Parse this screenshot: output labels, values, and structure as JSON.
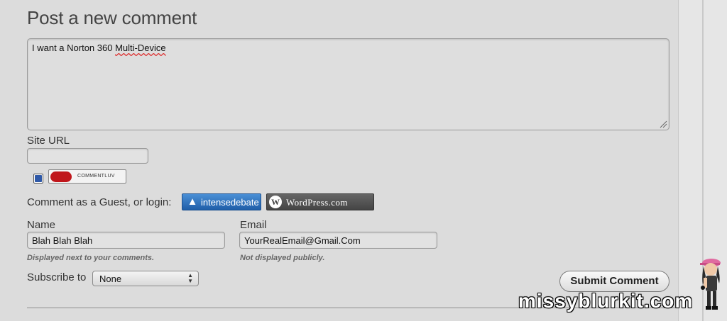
{
  "form": {
    "title": "Post a new comment",
    "comment_text_before": "I want a Norton 360 ",
    "comment_text_misspelled": "Multi-Device",
    "site_url_label": "Site URL",
    "site_url_value": "",
    "commentluv_checked": true,
    "commentluv_label": "COMMENTLUV",
    "guest_login_label": "Comment as a Guest, or login:",
    "intensedebate_label": "intensedebate",
    "wordpress_label": "WordPress.com",
    "name_label": "Name",
    "name_value": "Blah Blah Blah",
    "name_hint": "Displayed next to your comments.",
    "email_label": "Email",
    "email_value": "YourRealEmail@Gmail.Com",
    "email_hint": "Not displayed publicly.",
    "subscribe_label": "Subscribe to",
    "subscribe_value": "None",
    "submit_label": "Submit Comment"
  },
  "watermark": "missyblurkit.com",
  "colors": {
    "intensedebate": "#2a6cb8",
    "wordpress": "#555555",
    "heart": "#c0161b",
    "spellcheck": "#dd3333"
  }
}
